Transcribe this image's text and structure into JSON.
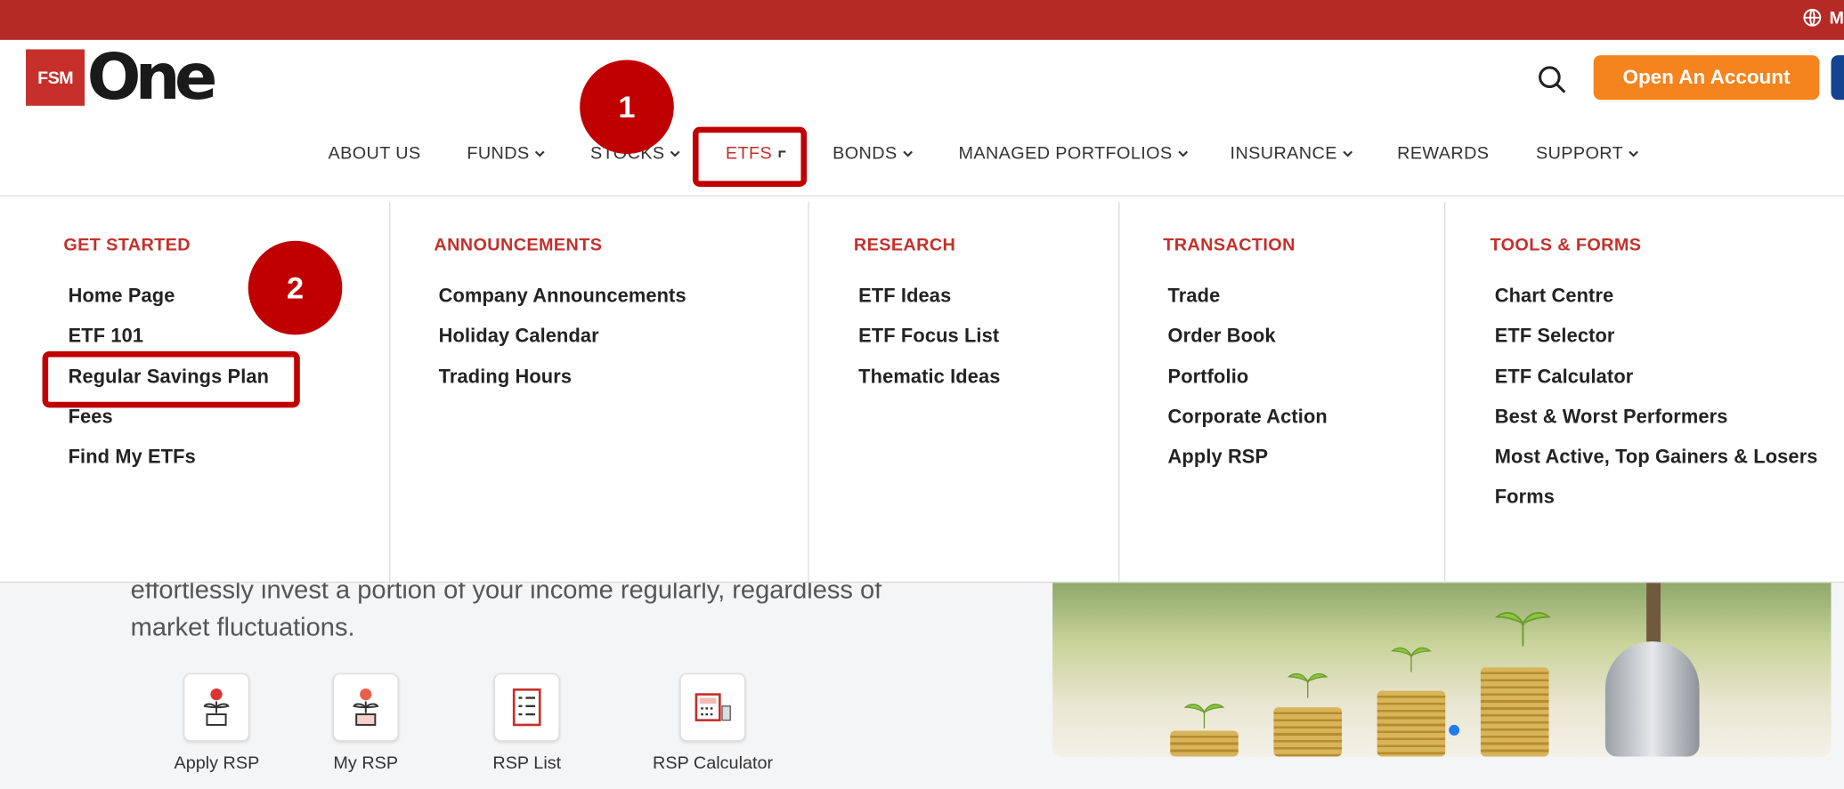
{
  "topbar": {
    "language_label": "M"
  },
  "logo": {
    "box_text": "FSM",
    "wordmark": "One"
  },
  "header": {
    "open_account_label": "Open An Account"
  },
  "nav": {
    "items": [
      {
        "label": "ABOUT US",
        "has_dropdown": false
      },
      {
        "label": "FUNDS",
        "has_dropdown": true
      },
      {
        "label": "STOCKS",
        "has_dropdown": true
      },
      {
        "label": "ETFS",
        "has_dropdown": true,
        "active": true
      },
      {
        "label": "BONDS",
        "has_dropdown": true
      },
      {
        "label": "MANAGED PORTFOLIOS",
        "has_dropdown": true
      },
      {
        "label": "INSURANCE",
        "has_dropdown": true
      },
      {
        "label": "REWARDS",
        "has_dropdown": false
      },
      {
        "label": "SUPPORT",
        "has_dropdown": true
      }
    ]
  },
  "annotations": {
    "step1": "1",
    "step2": "2"
  },
  "mega_menu": {
    "columns": [
      {
        "title": "GET STARTED",
        "items": [
          "Home Page",
          "ETF 101",
          "Regular Savings Plan",
          "Fees",
          "Find My ETFs"
        ]
      },
      {
        "title": "ANNOUNCEMENTS",
        "items": [
          "Company Announcements",
          "Holiday Calendar",
          "Trading Hours"
        ]
      },
      {
        "title": "RESEARCH",
        "items": [
          "ETF Ideas",
          "ETF Focus List",
          "Thematic Ideas"
        ]
      },
      {
        "title": "TRANSACTION",
        "items": [
          "Trade",
          "Order Book",
          "Portfolio",
          "Corporate Action",
          "Apply RSP"
        ]
      },
      {
        "title": "TOOLS & FORMS",
        "items": [
          "Chart Centre",
          "ETF Selector",
          "ETF Calculator",
          "Best & Worst Performers",
          "Most Active, Top Gainers & Losers",
          "Forms"
        ]
      }
    ]
  },
  "hero": {
    "line1": "effortlessly invest a portion of your income regularly, regardless of",
    "line2": "market fluctuations."
  },
  "quick_links": [
    {
      "label": "Apply RSP",
      "icon": "plant-coin-icon"
    },
    {
      "label": "My RSP",
      "icon": "plant-dollar-icon"
    },
    {
      "label": "RSP List",
      "icon": "checklist-icon"
    },
    {
      "label": "RSP Calculator",
      "icon": "calculator-icon"
    }
  ],
  "colors": {
    "brand_red": "#b52a25",
    "accent_orange": "#f5841f",
    "highlight_red": "#c00000"
  }
}
